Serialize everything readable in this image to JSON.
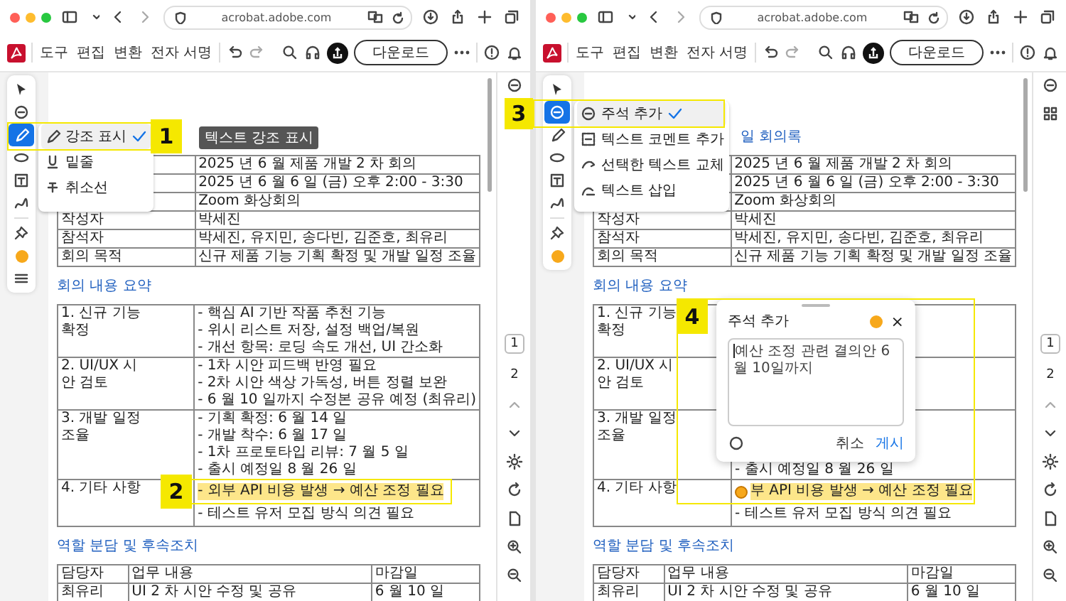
{
  "panes": [
    {
      "browser": {
        "url": "acrobat.adobe.com"
      },
      "toolbar": {
        "menus": [
          "도구",
          "편집",
          "변환",
          "전자 서명"
        ],
        "download": "다운로드"
      },
      "tools": [
        {
          "kind": "select",
          "selected": false
        },
        {
          "kind": "comment",
          "selected": false
        },
        {
          "kind": "highlight",
          "selected": true
        },
        {
          "kind": "shape",
          "selected": false
        },
        {
          "kind": "text",
          "selected": false
        },
        {
          "kind": "draw",
          "selected": false
        },
        {
          "kind": "pin",
          "selected": false
        },
        {
          "kind": "color",
          "selected": false,
          "color": "#f7a81b"
        },
        {
          "kind": "menu",
          "selected": false
        }
      ],
      "tool_menu": [
        {
          "kind": "highlight",
          "label": "강조 표시",
          "selected": true
        },
        {
          "kind": "underline",
          "label": "밑줄",
          "selected": false
        },
        {
          "kind": "strike",
          "label": "취소선",
          "selected": false
        }
      ],
      "tooltip": "텍스트 강조 표시",
      "document": {
        "info": [
          {
            "value": "2025 년 6 월 제품 개발 2 차 회의"
          },
          {
            "value": "2025 년 6 월 6 일 (금) 오후 2:00 - 3:30"
          },
          {
            "value": "Zoom 화상회의"
          },
          {
            "label": "작성자",
            "value": "박세진"
          },
          {
            "label": "참석자",
            "value": "박세진, 유지민, 송다빈, 김준호, 최유리"
          },
          {
            "label": "회의 목적",
            "value": "신규 제품 기능 기획 확정 및 개발 일정 조율"
          }
        ],
        "summary_heading": "회의 내용 요약",
        "summary": [
          {
            "topic": "1. 신규 기능 확정",
            "bullets": [
              "- 핵심 AI 기반 작품 추천 기능",
              "- 위시 리스트 저장, 설정 백업/복원",
              "- 개선 항목: 로딩 속도 개선, UI 간소화"
            ]
          },
          {
            "topic": "2. UI/UX 시안 검토",
            "bullets": [
              "- 1차 시안 피드백 반영 필요",
              "- 2차 시안 색상 가독성, 버튼 정렬 보완",
              "- 6 월 10 일까지 수정본 공유 예정 (최유리)"
            ]
          },
          {
            "topic": "3. 개발 일정 조율",
            "bullets": [
              "- 기획 확정: 6 월 14 일",
              "- 개발 착수: 6 월 17 일",
              "- 1차 프로토타입 리뷰: 7 월 5 일",
              "- 출시 예정일 8 월 26 일"
            ]
          },
          {
            "topic": "4. 기타 사항",
            "bullets": [
              {
                "text": "- 외부 API 비용 발생 → 예산 조정 필요",
                "highlighted": true,
                "comment": false
              },
              {
                "text": "- 테스트 유저 모집 방식 의견 필요",
                "highlighted": false,
                "comment": false
              }
            ]
          }
        ],
        "tasks_heading": "역할 분담 및 후속조치",
        "tasks": {
          "columns": [
            "담당자",
            "업무 내용",
            "마감일"
          ],
          "rows": [
            [
              "최유리",
              "UI 2 차 시안 수정 및 공유",
              "6 월 10 일"
            ]
          ]
        }
      },
      "pages": [
        {
          "label": "1",
          "selected": true
        },
        {
          "label": "2",
          "selected": false
        }
      ]
    },
    {
      "browser": {
        "url": "acrobat.adobe.com"
      },
      "toolbar": {
        "menus": [
          "도구",
          "편집",
          "변환",
          "전자 서명"
        ],
        "download": "다운로드"
      },
      "tools": [
        {
          "kind": "select",
          "selected": false
        },
        {
          "kind": "comment",
          "selected": true
        },
        {
          "kind": "highlight",
          "selected": false
        },
        {
          "kind": "shape",
          "selected": false
        },
        {
          "kind": "text",
          "selected": false
        },
        {
          "kind": "draw",
          "selected": false
        },
        {
          "kind": "pin",
          "selected": false
        },
        {
          "kind": "color",
          "selected": false,
          "color": "#f7a81b"
        }
      ],
      "tool_menu": [
        {
          "kind": "comment",
          "label": "주석 추가",
          "selected": true
        },
        {
          "kind": "textcomment",
          "label": "텍스트 코멘트 추가",
          "selected": false
        },
        {
          "kind": "replace",
          "label": "선택한 텍스트 교체",
          "selected": false
        },
        {
          "kind": "insert",
          "label": "텍스트 삽입",
          "selected": false
        }
      ],
      "document": {
        "title": "일 회의록",
        "info": [
          {
            "value": "2025 년 6 월 제품 개발 2 차 회의"
          },
          {
            "value": "2025 년 6 월 6 일 (금) 오후 2:00 - 3:30"
          },
          {
            "value": "Zoom 화상회의"
          },
          {
            "label": "작성자",
            "value": "박세진"
          },
          {
            "label": "참석자",
            "value": "박세진, 유지민, 송다빈, 김준호, 최유리"
          },
          {
            "label": "회의 목적",
            "value": "신규 제품 기능 기획 확정 및 개발 일정 조율"
          }
        ],
        "summary_heading": "회의 내용 요약",
        "summary": [
          {
            "topic": "1. 신규 기능 확정"
          },
          {
            "topic": "2. UI/UX 시안 검토"
          },
          {
            "topic": "3. 개발 일정 조율",
            "bullets": [
              "- 출시 예정일 8 월 26 일"
            ]
          },
          {
            "topic": "4. 기타 사항",
            "bullets": [
              {
                "text": "부 API 비용 발생 → 예산 조정 필요",
                "highlighted": true,
                "comment": true
              },
              {
                "text": "- 테스트 유저 모집 방식 의견 필요",
                "highlighted": false,
                "comment": false
              }
            ]
          }
        ],
        "tasks_heading": "역할 분담 및 후속조치",
        "tasks": {
          "columns": [
            "담당자",
            "업무 내용",
            "마감일"
          ],
          "rows": [
            [
              "최유리",
              "UI 2 차 시안 수정 및 공유",
              "6 월 10 일"
            ]
          ]
        }
      },
      "comment": {
        "title": "주석 추가",
        "color": "#f7a81b",
        "close": "×",
        "value": "예산 조정 관련 결의안 6월 10일까지",
        "cancel": "취소",
        "post": "게시"
      },
      "pages": [
        {
          "label": "1",
          "selected": true
        },
        {
          "label": "2",
          "selected": false
        }
      ]
    }
  ],
  "callouts": [
    {
      "label": "1"
    },
    {
      "label": "2"
    },
    {
      "label": "3"
    },
    {
      "label": "4"
    }
  ]
}
